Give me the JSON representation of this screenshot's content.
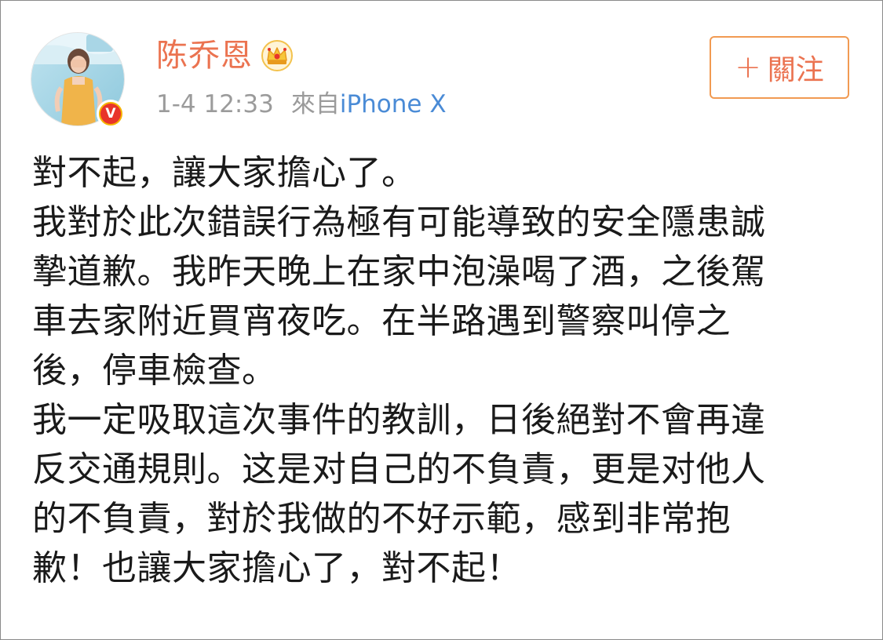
{
  "post": {
    "user_name": "陈乔恩",
    "time": "1-4 12:33",
    "source_prefix": "來自",
    "source_device": "iPhone X",
    "follow_label": "關注",
    "body_lines": [
      "對不起，讓大家擔心了。",
      "我對於此次錯誤行為極有可能導致的安全隱患誠",
      "摯道歉。我昨天晚上在家中泡澡喝了酒，之後駕",
      "車去家附近買宵夜吃。在半路遇到警察叫停之",
      "後，停車檢查。",
      "我一定吸取這次事件的教訓，日後絕對不會再違",
      "反交通規則。这是对自己的不負責，更是对他人",
      "的不負責，對於我做的不好示範，感到非常抱",
      "歉！也讓大家擔心了，對不起！"
    ],
    "icons": {
      "avatar": "avatar-photo",
      "verified": "verified-badge-icon",
      "membership": "crown-icon",
      "follow": "plus-icon"
    },
    "colors": {
      "name": "#eb7350",
      "meta": "#9b9b9b",
      "link": "#4a8bd6",
      "follow_border": "#f19a52",
      "badge_red": "#e8342a",
      "badge_gold": "#f6b300"
    }
  }
}
